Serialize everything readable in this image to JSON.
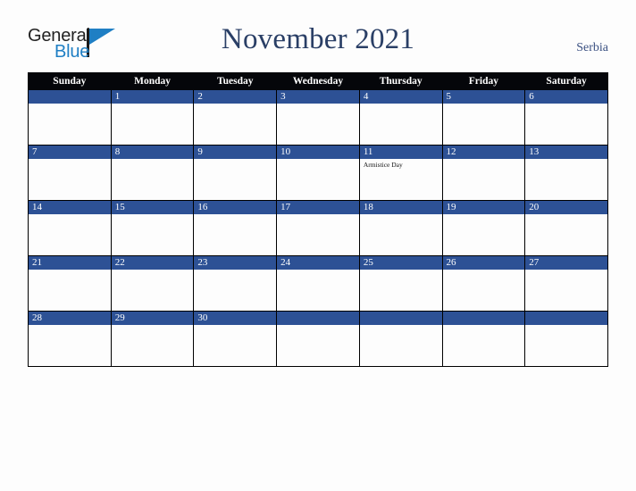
{
  "brand": {
    "name_part1": "General",
    "name_part2": "Blue",
    "triangle_icon": "triangle-icon"
  },
  "header": {
    "title": "November 2021",
    "region": "Serbia"
  },
  "colors": {
    "accent_blue": "#2d5195",
    "header_black": "#05060a",
    "title_navy": "#2a3f66",
    "logo_blue": "#1f7fc4",
    "page_background": "#fdfdfd"
  },
  "calendar": {
    "weekday_headers": [
      "Sunday",
      "Monday",
      "Tuesday",
      "Wednesday",
      "Thursday",
      "Friday",
      "Saturday"
    ],
    "weeks": [
      [
        {
          "day": "",
          "events": []
        },
        {
          "day": "1",
          "events": []
        },
        {
          "day": "2",
          "events": []
        },
        {
          "day": "3",
          "events": []
        },
        {
          "day": "4",
          "events": []
        },
        {
          "day": "5",
          "events": []
        },
        {
          "day": "6",
          "events": []
        }
      ],
      [
        {
          "day": "7",
          "events": []
        },
        {
          "day": "8",
          "events": []
        },
        {
          "day": "9",
          "events": []
        },
        {
          "day": "10",
          "events": []
        },
        {
          "day": "11",
          "events": [
            "Armistice Day"
          ]
        },
        {
          "day": "12",
          "events": []
        },
        {
          "day": "13",
          "events": []
        }
      ],
      [
        {
          "day": "14",
          "events": []
        },
        {
          "day": "15",
          "events": []
        },
        {
          "day": "16",
          "events": []
        },
        {
          "day": "17",
          "events": []
        },
        {
          "day": "18",
          "events": []
        },
        {
          "day": "19",
          "events": []
        },
        {
          "day": "20",
          "events": []
        }
      ],
      [
        {
          "day": "21",
          "events": []
        },
        {
          "day": "22",
          "events": []
        },
        {
          "day": "23",
          "events": []
        },
        {
          "day": "24",
          "events": []
        },
        {
          "day": "25",
          "events": []
        },
        {
          "day": "26",
          "events": []
        },
        {
          "day": "27",
          "events": []
        }
      ],
      [
        {
          "day": "28",
          "events": []
        },
        {
          "day": "29",
          "events": []
        },
        {
          "day": "30",
          "events": []
        },
        {
          "day": "",
          "events": []
        },
        {
          "day": "",
          "events": []
        },
        {
          "day": "",
          "events": []
        },
        {
          "day": "",
          "events": []
        }
      ]
    ]
  }
}
